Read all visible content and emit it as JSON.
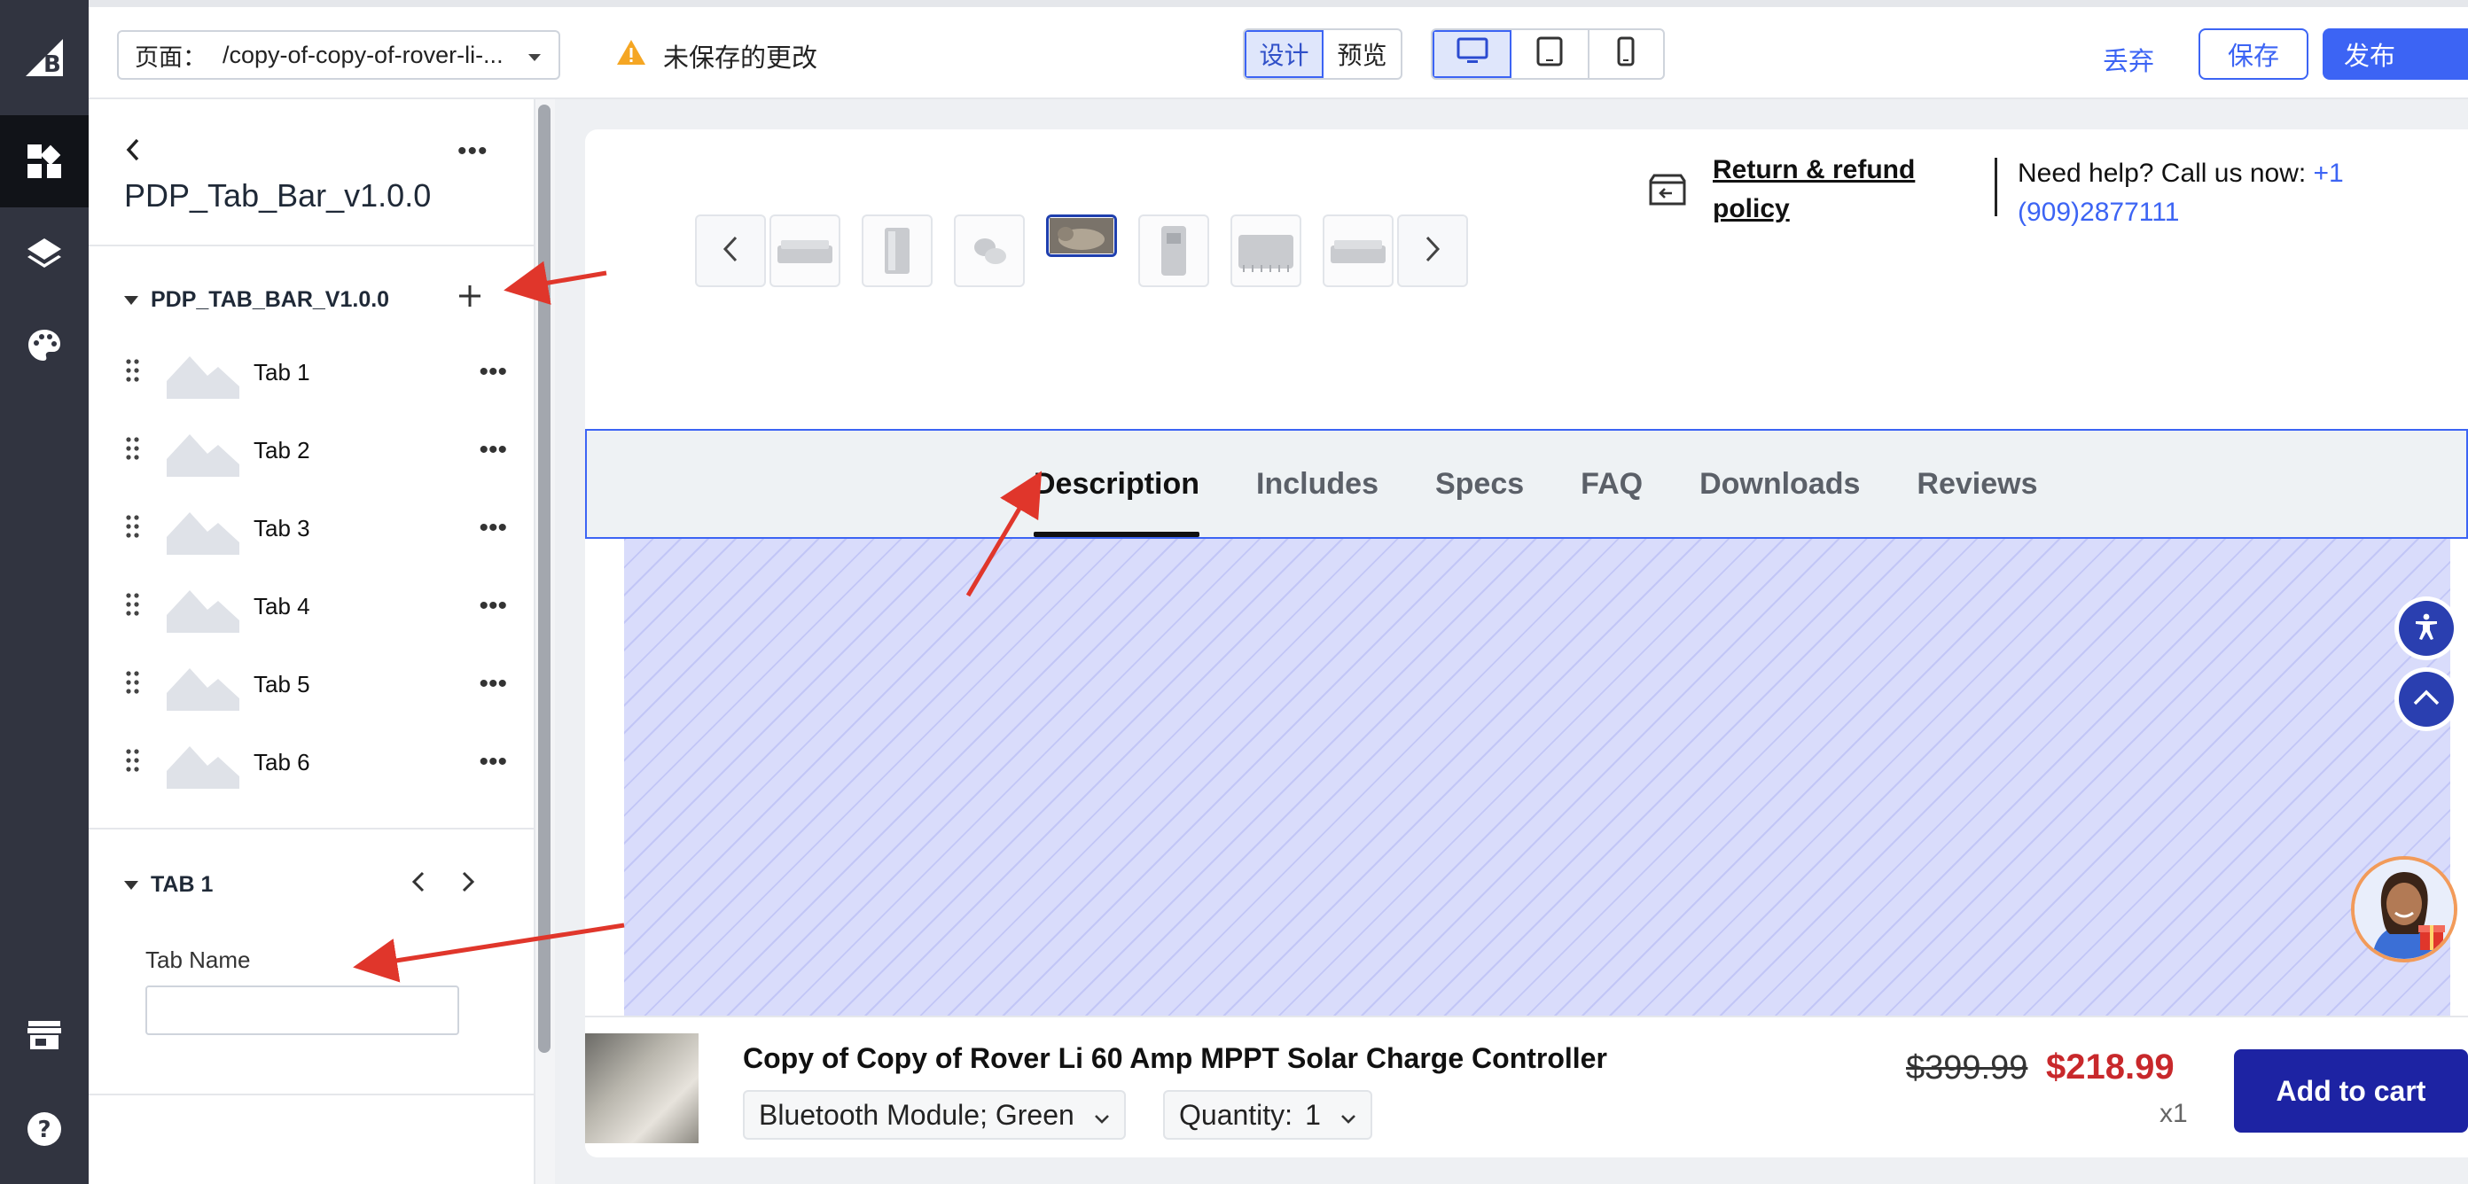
{
  "topbar": {
    "page_label": "页面：",
    "page_value": "/copy-of-copy-of-rover-li-...",
    "unsaved": "未保存的更改",
    "mode_design": "设计",
    "mode_preview": "预览",
    "discard": "丢弃",
    "save": "保存",
    "publish": "发布"
  },
  "panel": {
    "title": "PDP_Tab_Bar_v1.0.0",
    "section": "PDP_TAB_BAR_V1.0.0",
    "tabs": [
      "Tab 1",
      "Tab 2",
      "Tab 3",
      "Tab 4",
      "Tab 5",
      "Tab 6"
    ],
    "tab_section": "TAB 1",
    "field_label": "Tab Name",
    "field_value": ""
  },
  "preview": {
    "return_policy": "Return & refund policy",
    "help_prefix": "Need help? Call us now: ",
    "help_phone": "+1 (909)2877111",
    "tabs": [
      "Description",
      "Includes",
      "Specs",
      "FAQ",
      "Downloads",
      "Reviews"
    ],
    "active_tab": "Description",
    "product_name": "Copy of Copy of Rover Li 60 Amp MPPT Solar Charge Controller",
    "variant": "Bluetooth Module; Green",
    "quantity_label": "Quantity:",
    "quantity_value": "1",
    "old_price": "$399.99",
    "new_price": "$218.99",
    "qty_x": "x1",
    "add_to_cart": "Add to cart"
  },
  "colors": {
    "accent": "#3c64f4",
    "rail": "#313440",
    "price": "#c8282b",
    "cart_button": "#1d23a3",
    "annotation": "#e0362b"
  },
  "icons": {
    "rail": [
      "bigcommerce-logo-icon",
      "widgets-icon",
      "layers-icon",
      "palette-icon",
      "storefront-icon",
      "help-icon"
    ]
  }
}
